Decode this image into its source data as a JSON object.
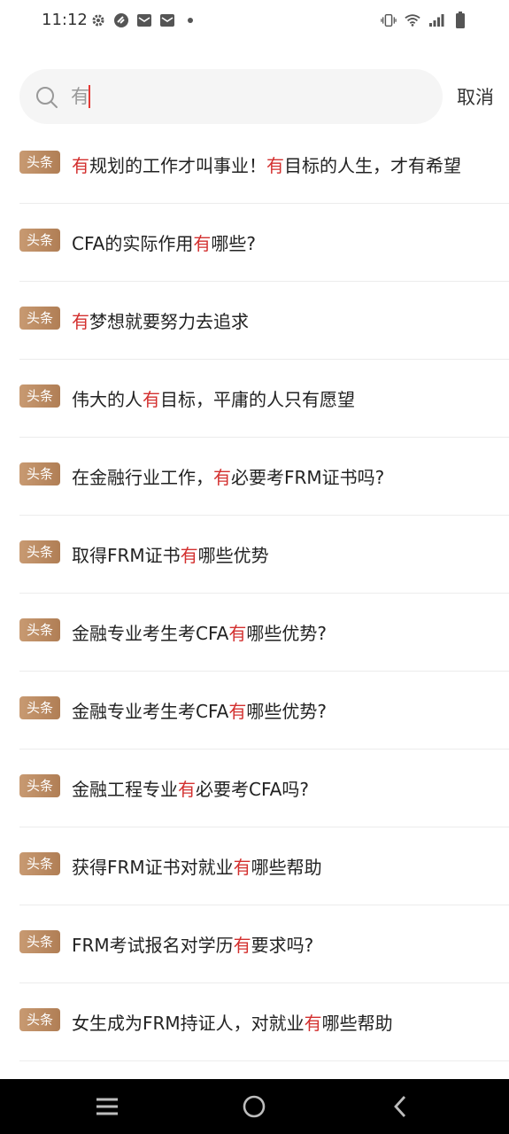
{
  "status_bar": {
    "time": "11:12",
    "left_icons": [
      "gear-icon",
      "vpn-icon",
      "mail-icon",
      "mail-icon",
      "dot-icon"
    ],
    "right_icons": [
      "vibrate-icon",
      "wifi-icon",
      "signal-icon",
      "battery-icon"
    ]
  },
  "search": {
    "query": "有",
    "cancel_label": "取消"
  },
  "colors": {
    "highlight": "#d3302f",
    "badge": "#b98a62",
    "nav_bg": "#000000"
  },
  "results": [
    {
      "badge": "头条",
      "pre": "",
      "hl": "有",
      "post": "规划的工作才叫事业！有目标的人生，才有希望"
    },
    {
      "badge": "头条",
      "pre": "CFA的实际作用",
      "hl": "有",
      "post": "哪些?"
    },
    {
      "badge": "头条",
      "pre": "",
      "hl": "有",
      "post": "梦想就要努力去追求"
    },
    {
      "badge": "头条",
      "pre": "伟大的人",
      "hl": "有",
      "post": "目标，平庸的人只有愿望"
    },
    {
      "badge": "头条",
      "pre": "在金融行业工作，",
      "hl": "有",
      "post": "必要考FRM证书吗?"
    },
    {
      "badge": "头条",
      "pre": "取得FRM证书",
      "hl": "有",
      "post": "哪些优势"
    },
    {
      "badge": "头条",
      "pre": "金融专业考生考CFA",
      "hl": "有",
      "post": "哪些优势?"
    },
    {
      "badge": "头条",
      "pre": "金融专业考生考CFA",
      "hl": "有",
      "post": "哪些优势?"
    },
    {
      "badge": "头条",
      "pre": "金融工程专业",
      "hl": "有",
      "post": "必要考CFA吗?"
    },
    {
      "badge": "头条",
      "pre": "获得FRM证书对就业",
      "hl": "有",
      "post": "哪些帮助"
    },
    {
      "badge": "头条",
      "pre": "FRM考试报名对学历",
      "hl": "有",
      "post": "要求吗?"
    },
    {
      "badge": "头条",
      "pre": "女生成为FRM持证人，对就业",
      "hl": "有",
      "post": "哪些帮助"
    }
  ],
  "nav_bar": {
    "buttons": [
      "menu-icon",
      "home-icon",
      "back-icon"
    ]
  }
}
